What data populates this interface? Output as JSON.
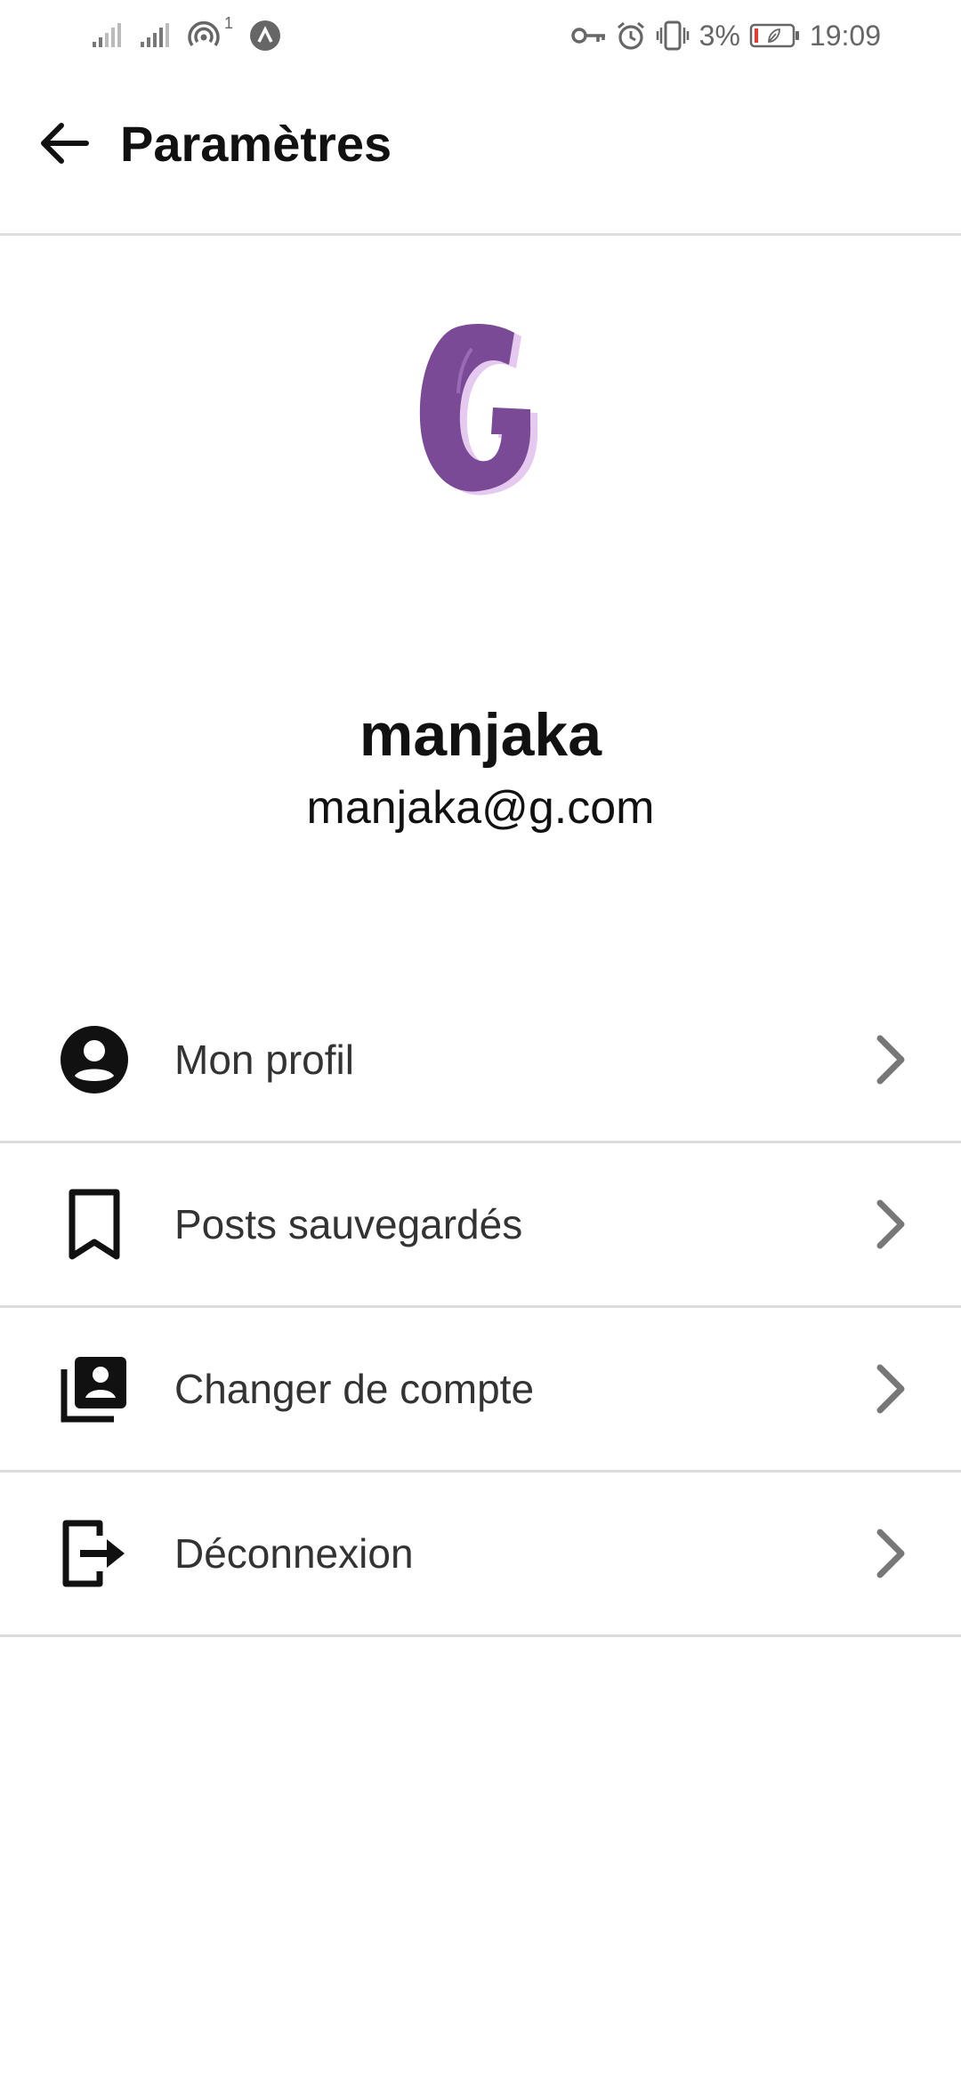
{
  "status_bar": {
    "battery_percent": "3%",
    "time": "19:09",
    "sim_badge": "1",
    "icons": [
      "signal-icon",
      "signal-icon",
      "hotspot-icon",
      "vpn-icon",
      "key-icon",
      "alarm-icon",
      "vibrate-icon",
      "battery-icon"
    ]
  },
  "header": {
    "title": "Paramètres",
    "back_icon": "arrow-back-icon"
  },
  "profile": {
    "logo_letter": "G",
    "logo_color": "#7b4a97",
    "username": "manjaka",
    "email": "manjaka@g.com"
  },
  "menu": {
    "items": [
      {
        "label": "Mon profil",
        "icon": "account-circle-icon"
      },
      {
        "label": "Posts sauvegardés",
        "icon": "bookmark-icon"
      },
      {
        "label": "Changer de compte",
        "icon": "switch-account-icon"
      },
      {
        "label": "Déconnexion",
        "icon": "logout-icon"
      }
    ],
    "chevron_icon": "chevron-right-icon"
  },
  "colors": {
    "text": "#111111",
    "menu_text": "#333333",
    "chevron": "#777777",
    "divider": "#dcdcdc",
    "accent_purple": "#7b4a97"
  }
}
